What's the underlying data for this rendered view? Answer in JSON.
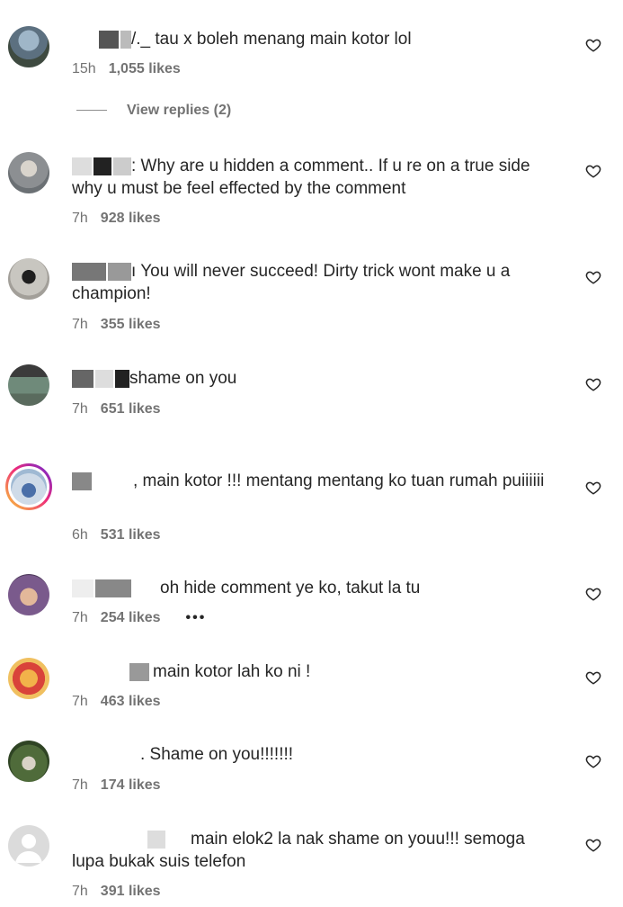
{
  "comments": [
    {
      "text": "/._ tau x boleh menang main kotor lol",
      "time": "15h",
      "likes": "1,055 likes"
    },
    {
      "text": ": Why are u hidden a comment.. If u re on a true side why u must be feel effected by the comment",
      "time": "7h",
      "likes": "928 likes"
    },
    {
      "text": "ı You will never succeed! Dirty trick wont make u a champion!",
      "time": "7h",
      "likes": "355 likes"
    },
    {
      "text": "shame on you",
      "time": "7h",
      "likes": "651 likes"
    },
    {
      "text": ", main kotor !!! mentang mentang ko tuan rumah puiiiiii",
      "time": "6h",
      "likes": "531 likes"
    },
    {
      "text": "oh hide comment ye ko, takut la tu",
      "time": "7h",
      "likes": "254 likes",
      "more": "•••"
    },
    {
      "text": "main kotor lah ko ni !",
      "time": "7h",
      "likes": "463 likes"
    },
    {
      "text": ". Shame on you!!!!!!!",
      "time": "7h",
      "likes": "174 likes"
    },
    {
      "text": "main elok2 la nak shame on youu!!! semoga lupa bukak suis telefon",
      "time": "7h",
      "likes": "391 likes"
    }
  ],
  "view_replies": "View replies (2)",
  "icons": {
    "like": "heart-outline-icon",
    "more": "more-options-icon"
  },
  "colors": {
    "text": "#262626",
    "meta": "#737373"
  }
}
